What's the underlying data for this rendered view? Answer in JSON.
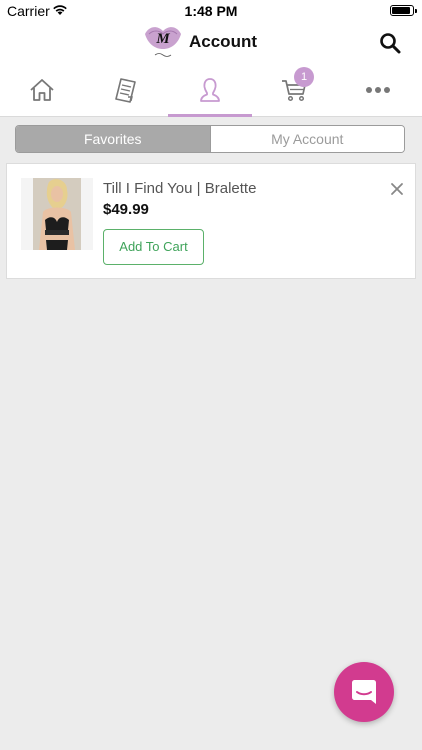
{
  "status_bar": {
    "carrier": "Carrier",
    "time": "1:48 PM"
  },
  "header": {
    "title": "Account",
    "logo_icon": "m-lips-logo"
  },
  "tabs": [
    {
      "icon": "home-icon",
      "active": false
    },
    {
      "icon": "document-icon",
      "active": false
    },
    {
      "icon": "user-icon",
      "active": true
    },
    {
      "icon": "cart-icon",
      "active": false,
      "badge": "1"
    },
    {
      "icon": "more-icon",
      "active": false
    }
  ],
  "segment": {
    "selected": "Favorites",
    "other": "My Account"
  },
  "favorites": [
    {
      "name": "Till I Find You | Bralette",
      "price": "$49.99",
      "button": "Add To Cart"
    }
  ],
  "colors": {
    "accent": "#c79ad0",
    "button_green": "#5bb16a",
    "chat_pink": "#d23b8f"
  }
}
